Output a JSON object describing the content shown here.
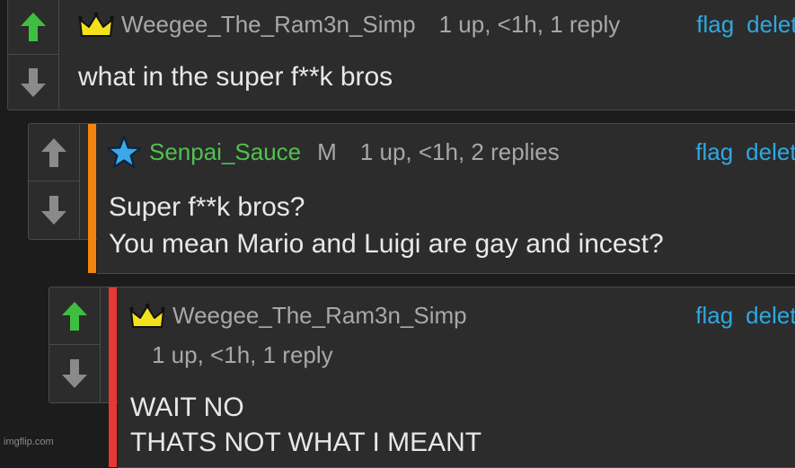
{
  "comments": [
    {
      "username": "Weegee_The_Ram3n_Simp",
      "meta": "1 up, <1h, 1 reply",
      "flag": "flag",
      "delete": "delete",
      "text": "what in the super f**k bros",
      "badge_icon": "crown-icon",
      "upvoted": true
    },
    {
      "username": "Senpai_Sauce",
      "mod_badge": "M",
      "meta": "1 up, <1h, 2 replies",
      "flag": "flag",
      "delete": "delete",
      "text_lines": [
        "Super f**k bros?",
        "You mean Mario and Luigi are gay and incest?"
      ],
      "badge_icon": "star-icon",
      "indent_bar_color": "#f7830f",
      "upvoted": false
    },
    {
      "username": "Weegee_The_Ram3n_Simp",
      "meta": "1 up, <1h, 1 reply",
      "flag": "flag",
      "delete": "delete",
      "text_lines": [
        "WAIT NO",
        "THATS NOT WHAT I MEANT"
      ],
      "badge_icon": "crown-icon",
      "indent_bar_color": "#e53935",
      "upvoted": true
    }
  ],
  "watermark": "imgflip.com",
  "colors": {
    "upvote_active": "#3fbf3f",
    "vote_inactive": "#8a8a8a",
    "username_green": "#4fc24f",
    "link_blue": "#2ea8e0",
    "crown_yellow": "#f2e21a"
  }
}
